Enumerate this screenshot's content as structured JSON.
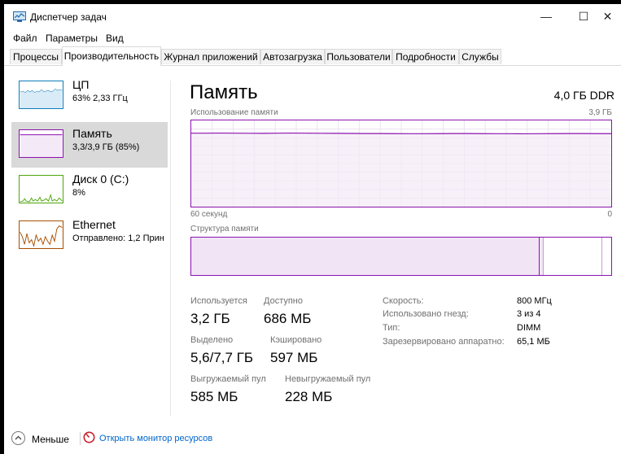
{
  "app": {
    "title": "Диспетчер задач"
  },
  "window_controls": {
    "minimize": "—",
    "maximize": "☐",
    "close": "✕"
  },
  "menu": [
    "Файл",
    "Параметры",
    "Вид"
  ],
  "tabs": [
    {
      "label": "Процессы",
      "active": false
    },
    {
      "label": "Производительность",
      "active": true
    },
    {
      "label": "Журнал приложений",
      "active": false
    },
    {
      "label": "Автозагрузка",
      "active": false
    },
    {
      "label": "Пользователи",
      "active": false
    },
    {
      "label": "Подробности",
      "active": false
    },
    {
      "label": "Службы",
      "active": false
    }
  ],
  "resources": [
    {
      "title": "ЦП",
      "subtitle": "63% 2,33 ГГц",
      "color": "#117dbb",
      "selected": false
    },
    {
      "title": "Память",
      "subtitle": "3,3/3,9 ГБ (85%)",
      "color": "#8b12ae",
      "selected": true
    },
    {
      "title": "Диск 0 (C:)",
      "subtitle": "8%",
      "color": "#4da60c",
      "selected": false
    },
    {
      "title": "Ethernet",
      "subtitle": "Отправлено: 1,2 Прин",
      "color": "#a74f01",
      "selected": false
    }
  ],
  "memory": {
    "title": "Память",
    "total": "4,0 ГБ DDR",
    "usage_label": "Использование памяти",
    "usage_max": "3,9 ГБ",
    "time_label": "60 секунд",
    "time_end": "0",
    "structure_label": "Структура памяти",
    "accent_color": "#8b12ae",
    "usage_history_fraction": [
      0.852,
      0.852,
      0.853,
      0.852,
      0.851,
      0.85,
      0.852,
      0.853,
      0.852,
      0.851,
      0.85,
      0.849,
      0.848,
      0.848,
      0.847,
      0.846,
      0.846,
      0.847,
      0.848,
      0.848,
      0.847,
      0.846,
      0.846,
      0.845,
      0.846,
      0.847,
      0.848,
      0.848,
      0.847,
      0.847
    ],
    "stats": {
      "in_use_label": "Используется",
      "in_use_value": "3,2 ГБ",
      "available_label": "Доступно",
      "available_value": "686 МБ",
      "committed_label": "Выделено",
      "committed_value": "5,6/7,7 ГБ",
      "cached_label": "Кэшировано",
      "cached_value": "597 МБ",
      "paged_label": "Выгружаемый пул",
      "paged_value": "585 МБ",
      "nonpaged_label": "Невыгружаемый пул",
      "nonpaged_value": "228 МБ"
    },
    "details": [
      {
        "label": "Скорость:",
        "value": "800 МГц"
      },
      {
        "label": "Использовано гнезд:",
        "value": "3 из 4"
      },
      {
        "label": "Тип:",
        "value": "DIMM"
      },
      {
        "label": "Зарезервировано аппаратно:",
        "value": "65,1 МБ"
      }
    ]
  },
  "footer": {
    "fewer": "Меньше",
    "monitor": "Открыть монитор ресурсов"
  }
}
